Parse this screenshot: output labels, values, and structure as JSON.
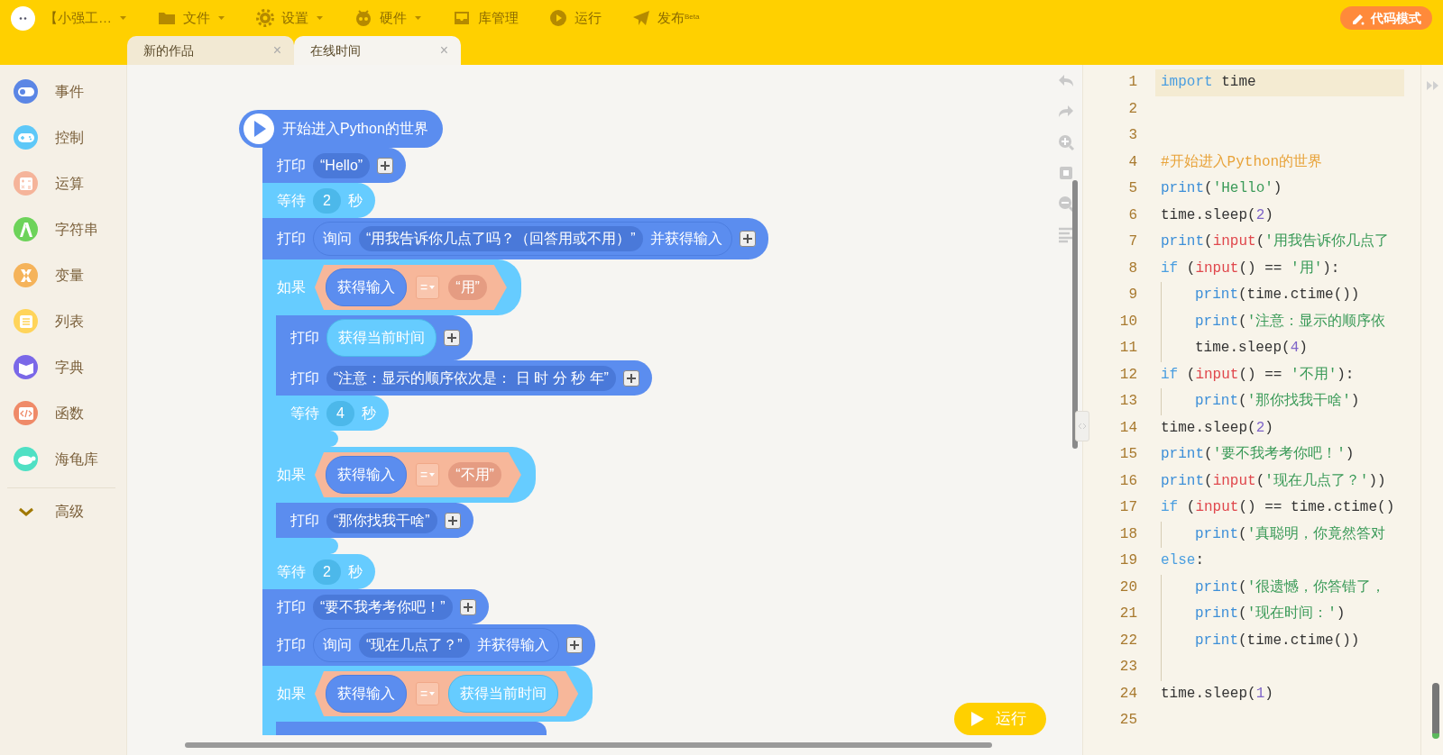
{
  "menu": [
    {
      "label": "【小强工…",
      "dropdown": true
    },
    {
      "label": "文件",
      "dropdown": true
    },
    {
      "label": "设置",
      "dropdown": true
    },
    {
      "label": "硬件",
      "dropdown": true
    },
    {
      "label": "库管理",
      "dropdown": false
    },
    {
      "label": "运行",
      "dropdown": false
    },
    {
      "label": "发布$^{Beta}$",
      "dropdown": false
    }
  ],
  "mode_button": "代码模式",
  "tabs": [
    {
      "label": "新的作品",
      "selected": false,
      "close": "×"
    },
    {
      "label": "在线时间",
      "selected": true,
      "close": "×"
    }
  ],
  "categories": [
    {
      "label": "事件",
      "kind": "category",
      "color": "#5b86e5"
    },
    {
      "label": "控制",
      "kind": "category",
      "color": "#5ec8f8"
    },
    {
      "label": "运算",
      "kind": "category",
      "color": "#f5b49a"
    },
    {
      "label": "字符串",
      "kind": "category",
      "color": "#6dd35a"
    },
    {
      "label": "变量",
      "kind": "category",
      "color": "#f5b35a"
    },
    {
      "label": "列表",
      "kind": "category",
      "color": "#ffd45a"
    },
    {
      "label": "字典",
      "kind": "category",
      "color": "#7a68e8"
    },
    {
      "label": "函数",
      "kind": "category",
      "color": "#ef8a68"
    },
    {
      "label": "海龟库",
      "kind": "category",
      "color": "#4fe0c4"
    },
    {
      "label": "高级",
      "kind": "more"
    }
  ],
  "script": {
    "hat": "开始进入Python的世界",
    "blocks": [
      {
        "kind": "print",
        "label": "打印",
        "add": true,
        "inputs": [
          {
            "kind": "string",
            "text": "“Hello”"
          }
        ]
      },
      {
        "kind": "wait",
        "label": "等待",
        "inputs": [
          {
            "kind": "number",
            "text": "2"
          },
          {
            "kind": "word",
            "text": "秒"
          }
        ]
      },
      {
        "kind": "print",
        "label": "打印",
        "add": true,
        "inputs": [
          {
            "kind": "ask",
            "label": "询问",
            "text": "“用我告诉你几点了吗？（回答用或不用）”",
            "suffix": "并获得输入"
          }
        ]
      },
      {
        "kind": "if",
        "label": "如果",
        "inputs": [
          {
            "kind": "compare",
            "left": {
              "kind": "input_reporter",
              "text": "获得输入"
            },
            "op": "=",
            "right": {
              "kind": "string",
              "text": "“用”"
            }
          }
        ],
        "children": [
          {
            "kind": "print",
            "label": "打印",
            "add": true,
            "inputs": [
              {
                "kind": "time_reporter",
                "text": "获得当前时间"
              }
            ]
          },
          {
            "kind": "print",
            "label": "打印",
            "add": true,
            "inputs": [
              {
                "kind": "string",
                "text": "“注意：显示的顺序依次是： 日 时 分 秒 年”"
              }
            ]
          },
          {
            "kind": "wait",
            "label": "等待",
            "inputs": [
              {
                "kind": "number",
                "text": "4"
              },
              {
                "kind": "word",
                "text": "秒"
              }
            ]
          }
        ]
      },
      {
        "kind": "if",
        "label": "如果",
        "inputs": [
          {
            "kind": "compare",
            "left": {
              "kind": "input_reporter",
              "text": "获得输入"
            },
            "op": "=",
            "right": {
              "kind": "string",
              "text": "“不用”"
            }
          }
        ],
        "children": [
          {
            "kind": "print",
            "label": "打印",
            "add": true,
            "inputs": [
              {
                "kind": "string",
                "text": "“那你找我干啥”"
              }
            ]
          }
        ]
      },
      {
        "kind": "wait",
        "label": "等待",
        "inputs": [
          {
            "kind": "number",
            "text": "2"
          },
          {
            "kind": "word",
            "text": "秒"
          }
        ]
      },
      {
        "kind": "print",
        "label": "打印",
        "add": true,
        "inputs": [
          {
            "kind": "string",
            "text": "“要不我考考你吧！”"
          }
        ]
      },
      {
        "kind": "print",
        "label": "打印",
        "add": true,
        "inputs": [
          {
            "kind": "ask",
            "label": "询问",
            "text": "“现在几点了？”",
            "suffix": "并获得输入"
          }
        ]
      },
      {
        "kind": "if",
        "label": "如果",
        "inputs": [
          {
            "kind": "compare",
            "left": {
              "kind": "input_reporter",
              "text": "获得输入"
            },
            "op": "=",
            "right": {
              "kind": "time_reporter",
              "text": "获得当前时间"
            }
          }
        ],
        "children": [
          {
            "kind": "print"
          }
        ]
      }
    ]
  },
  "run_button": "运行",
  "code": {
    "lines": [
      {
        "number": "1",
        "current": true,
        "indent": false,
        "tokens": [
          {
            "kind": "keyword",
            "text": "import"
          },
          {
            "kind": "plain",
            "text": " time"
          }
        ]
      },
      {
        "number": "2",
        "current": false,
        "indent": false
      },
      {
        "number": "3",
        "current": false,
        "indent": false
      },
      {
        "number": "4",
        "current": false,
        "indent": false,
        "tokens": [
          {
            "kind": "comment",
            "text": "#开始进入Python的世界"
          }
        ]
      },
      {
        "number": "5",
        "current": false,
        "indent": false,
        "tokens": [
          {
            "kind": "function",
            "text": "print"
          },
          {
            "kind": "plain",
            "text": "("
          },
          {
            "kind": "string",
            "text": "'Hello'"
          },
          {
            "kind": "plain",
            "text": ")"
          }
        ]
      },
      {
        "number": "6",
        "current": false,
        "indent": false,
        "tokens": [
          {
            "kind": "plain",
            "text": "time.sleep("
          },
          {
            "kind": "number",
            "text": "2"
          },
          {
            "kind": "plain",
            "text": ")"
          }
        ]
      },
      {
        "number": "7",
        "current": false,
        "indent": false,
        "tokens": [
          {
            "kind": "function",
            "text": "print"
          },
          {
            "kind": "plain",
            "text": "("
          },
          {
            "kind": "builtin",
            "text": "input"
          },
          {
            "kind": "plain",
            "text": "("
          },
          {
            "kind": "string",
            "text": "'用我告诉你几点了"
          }
        ]
      },
      {
        "number": "8",
        "current": false,
        "indent": false,
        "tokens": [
          {
            "kind": "keyword",
            "text": "if"
          },
          {
            "kind": "plain",
            "text": " ("
          },
          {
            "kind": "builtin",
            "text": "input"
          },
          {
            "kind": "plain",
            "text": "() == "
          },
          {
            "kind": "string",
            "text": "'用'"
          },
          {
            "kind": "plain",
            "text": "):"
          }
        ]
      },
      {
        "number": "9",
        "current": false,
        "indent": true,
        "tokens": [
          {
            "kind": "function",
            "text": "print"
          },
          {
            "kind": "plain",
            "text": "(time.ctime())"
          }
        ]
      },
      {
        "number": "10",
        "current": false,
        "indent": true,
        "tokens": [
          {
            "kind": "function",
            "text": "print"
          },
          {
            "kind": "plain",
            "text": "("
          },
          {
            "kind": "string",
            "text": "'注意：显示的顺序依"
          }
        ]
      },
      {
        "number": "11",
        "current": false,
        "indent": true,
        "tokens": [
          {
            "kind": "plain",
            "text": "time.sleep("
          },
          {
            "kind": "number",
            "text": "4"
          },
          {
            "kind": "plain",
            "text": ")"
          }
        ]
      },
      {
        "number": "12",
        "current": false,
        "indent": false,
        "tokens": [
          {
            "kind": "keyword",
            "text": "if"
          },
          {
            "kind": "plain",
            "text": " ("
          },
          {
            "kind": "builtin",
            "text": "input"
          },
          {
            "kind": "plain",
            "text": "() == "
          },
          {
            "kind": "string",
            "text": "'不用'"
          },
          {
            "kind": "plain",
            "text": "):"
          }
        ]
      },
      {
        "number": "13",
        "current": false,
        "indent": true,
        "tokens": [
          {
            "kind": "function",
            "text": "print"
          },
          {
            "kind": "plain",
            "text": "("
          },
          {
            "kind": "string",
            "text": "'那你找我干啥'"
          },
          {
            "kind": "plain",
            "text": ")"
          }
        ]
      },
      {
        "number": "14",
        "current": false,
        "indent": false,
        "tokens": [
          {
            "kind": "plain",
            "text": "time.sleep("
          },
          {
            "kind": "number",
            "text": "2"
          },
          {
            "kind": "plain",
            "text": ")"
          }
        ]
      },
      {
        "number": "15",
        "current": false,
        "indent": false,
        "tokens": [
          {
            "kind": "function",
            "text": "print"
          },
          {
            "kind": "plain",
            "text": "("
          },
          {
            "kind": "string",
            "text": "'要不我考考你吧！'"
          },
          {
            "kind": "plain",
            "text": ")"
          }
        ]
      },
      {
        "number": "16",
        "current": false,
        "indent": false,
        "tokens": [
          {
            "kind": "function",
            "text": "print"
          },
          {
            "kind": "plain",
            "text": "("
          },
          {
            "kind": "builtin",
            "text": "input"
          },
          {
            "kind": "plain",
            "text": "("
          },
          {
            "kind": "string",
            "text": "'现在几点了？'"
          },
          {
            "kind": "plain",
            "text": "))"
          }
        ]
      },
      {
        "number": "17",
        "current": false,
        "indent": false,
        "tokens": [
          {
            "kind": "keyword",
            "text": "if"
          },
          {
            "kind": "plain",
            "text": " ("
          },
          {
            "kind": "builtin",
            "text": "input"
          },
          {
            "kind": "plain",
            "text": "() == time.ctime()"
          }
        ]
      },
      {
        "number": "18",
        "current": false,
        "indent": true,
        "tokens": [
          {
            "kind": "function",
            "text": "print"
          },
          {
            "kind": "plain",
            "text": "("
          },
          {
            "kind": "string",
            "text": "'真聪明，你竟然答对"
          }
        ]
      },
      {
        "number": "19",
        "current": false,
        "indent": false,
        "tokens": [
          {
            "kind": "keyword",
            "text": "else"
          },
          {
            "kind": "plain",
            "text": ":"
          }
        ]
      },
      {
        "number": "20",
        "current": false,
        "indent": true,
        "tokens": [
          {
            "kind": "function",
            "text": "print"
          },
          {
            "kind": "plain",
            "text": "("
          },
          {
            "kind": "string",
            "text": "'很遗憾，你答错了，"
          }
        ]
      },
      {
        "number": "21",
        "current": false,
        "indent": true,
        "tokens": [
          {
            "kind": "function",
            "text": "print"
          },
          {
            "kind": "plain",
            "text": "("
          },
          {
            "kind": "string",
            "text": "'现在时间：'"
          },
          {
            "kind": "plain",
            "text": ")"
          }
        ]
      },
      {
        "number": "22",
        "current": false,
        "indent": true,
        "tokens": [
          {
            "kind": "function",
            "text": "print"
          },
          {
            "kind": "plain",
            "text": "(time.ctime())"
          }
        ]
      },
      {
        "number": "23",
        "current": false,
        "indent": true
      },
      {
        "number": "24",
        "current": false,
        "indent": false,
        "tokens": [
          {
            "kind": "plain",
            "text": "time.sleep("
          },
          {
            "kind": "number",
            "text": "1"
          },
          {
            "kind": "plain",
            "text": ")"
          }
        ]
      },
      {
        "number": "25",
        "current": false,
        "indent": false
      }
    ]
  }
}
